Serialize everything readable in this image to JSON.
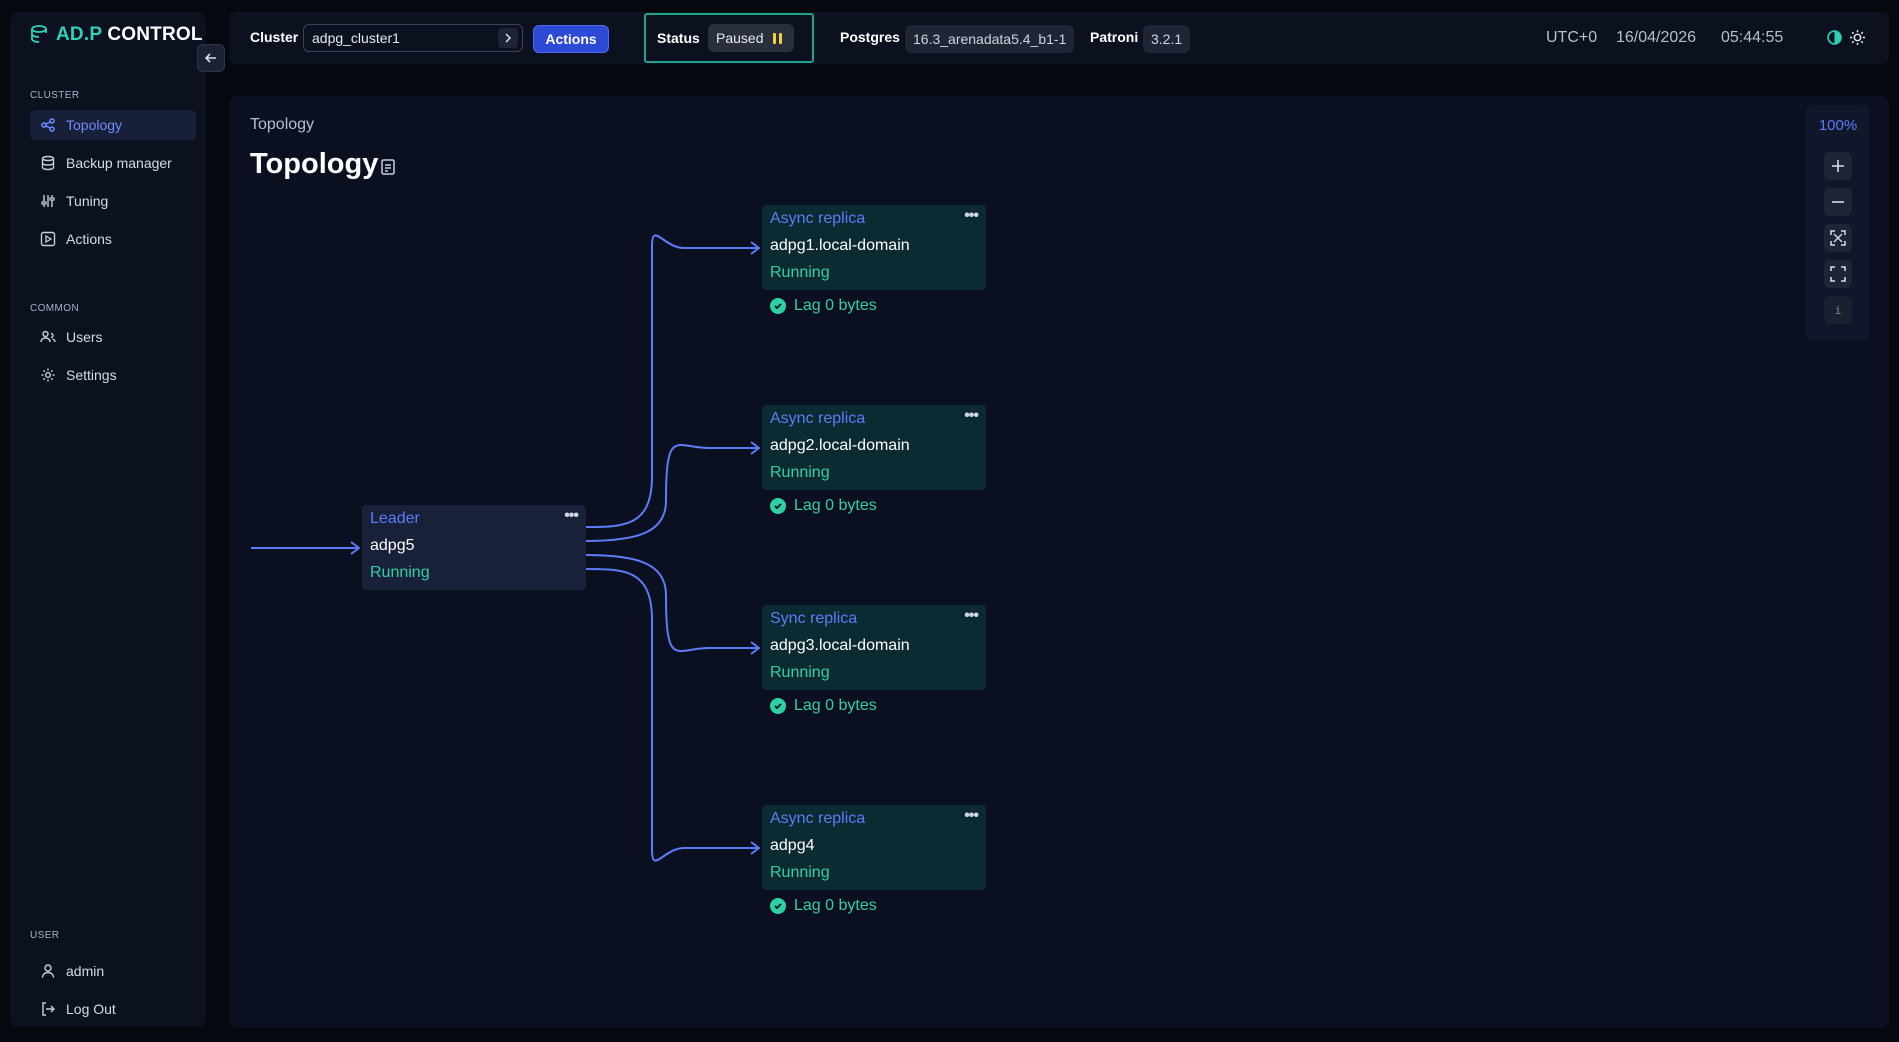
{
  "app": {
    "logo_brand": "AD.P",
    "logo_text": " CONTROL"
  },
  "sidebar": {
    "cluster_section": "CLUSTER",
    "cluster_items": [
      {
        "label": "Topology",
        "icon": "topology-icon",
        "active": true
      },
      {
        "label": "Backup manager",
        "icon": "database-icon"
      },
      {
        "label": "Tuning",
        "icon": "sliders-icon"
      },
      {
        "label": "Actions",
        "icon": "play-square-icon"
      }
    ],
    "common_section": "COMMON",
    "common_items": [
      {
        "label": "Users",
        "icon": "users-icon"
      },
      {
        "label": "Settings",
        "icon": "gear-icon"
      }
    ],
    "user_section": "USER",
    "user_items": [
      {
        "label": "admin",
        "icon": "user-icon"
      },
      {
        "label": "Log Out",
        "icon": "logout-icon"
      }
    ]
  },
  "header": {
    "cluster_label": "Cluster",
    "cluster_value": "adpg_cluster1",
    "actions_label": "Actions",
    "status_label": "Status",
    "status_value": "Paused",
    "postgres_label": "Postgres",
    "postgres_version": "16.3_arenadata5.4_b1-1",
    "patroni_label": "Patroni",
    "patroni_version": "3.2.1",
    "timezone": "UTC+0",
    "date": "16/04/2026",
    "time": "05:44:55",
    "colors": {
      "accent": "#2d4ad6",
      "status_border": "#1fa38a",
      "paused_icon": "#f2d23c"
    }
  },
  "main": {
    "breadcrumb": "Topology",
    "title": "Topology",
    "zoom_level": "100%",
    "zoom_buttons": [
      "zoom-in-icon",
      "zoom-out-icon",
      "fit-view-icon",
      "fullscreen-icon",
      "info-icon"
    ],
    "info_label": "i"
  },
  "topology": {
    "leader": {
      "role": "Leader",
      "host": "adpg5",
      "state": "Running"
    },
    "replicas": [
      {
        "role": "Async replica",
        "host": "adpg1.local-domain",
        "state": "Running",
        "lag": "Lag 0 bytes"
      },
      {
        "role": "Async replica",
        "host": "adpg2.local-domain",
        "state": "Running",
        "lag": "Lag 0 bytes"
      },
      {
        "role": "Sync replica",
        "host": "adpg3.local-domain",
        "state": "Running",
        "lag": "Lag 0 bytes"
      },
      {
        "role": "Async replica",
        "host": "adpg4",
        "state": "Running",
        "lag": "Lag 0 bytes"
      }
    ],
    "colors": {
      "edge": "#5c7cfa",
      "running": "#2fd0a4",
      "replica_bg": "#0c2a31",
      "leader_bg": "#18203a"
    }
  }
}
